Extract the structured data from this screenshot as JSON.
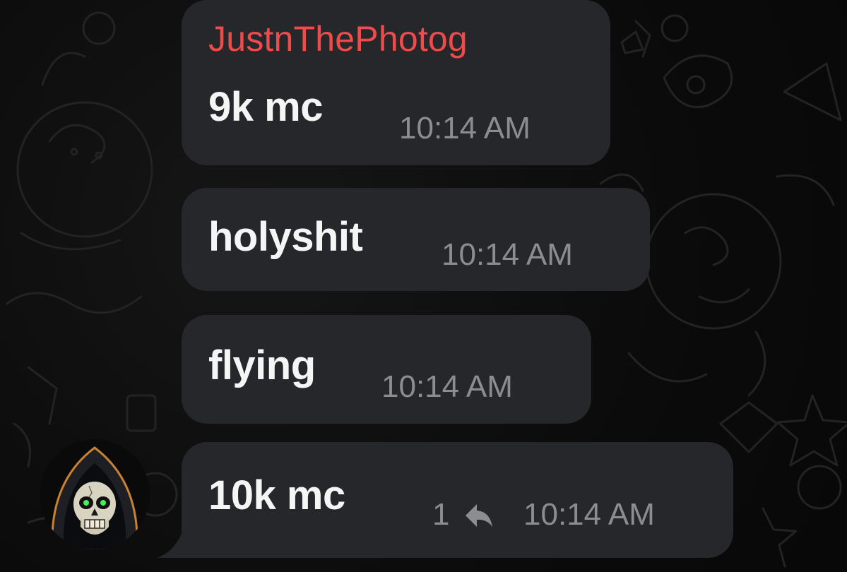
{
  "messages": [
    {
      "sender": "JustnThePhotog",
      "text": "9k mc",
      "time": "10:14 AM"
    },
    {
      "text": "holyshit",
      "time": "10:14 AM"
    },
    {
      "text": "flying",
      "time": "10:14 AM"
    },
    {
      "text": "10k mc",
      "time": "10:14 AM",
      "reply_count": "1",
      "reply_icon": "reply-icon"
    }
  ],
  "avatar": {
    "icon": "hooded-skull-avatar"
  },
  "colors": {
    "bubble": "#25272b",
    "sender_name": "#ee4b4b",
    "message_text": "#f5f5f5",
    "timestamp": "#8a8d92",
    "background": "#0d0d0d"
  }
}
